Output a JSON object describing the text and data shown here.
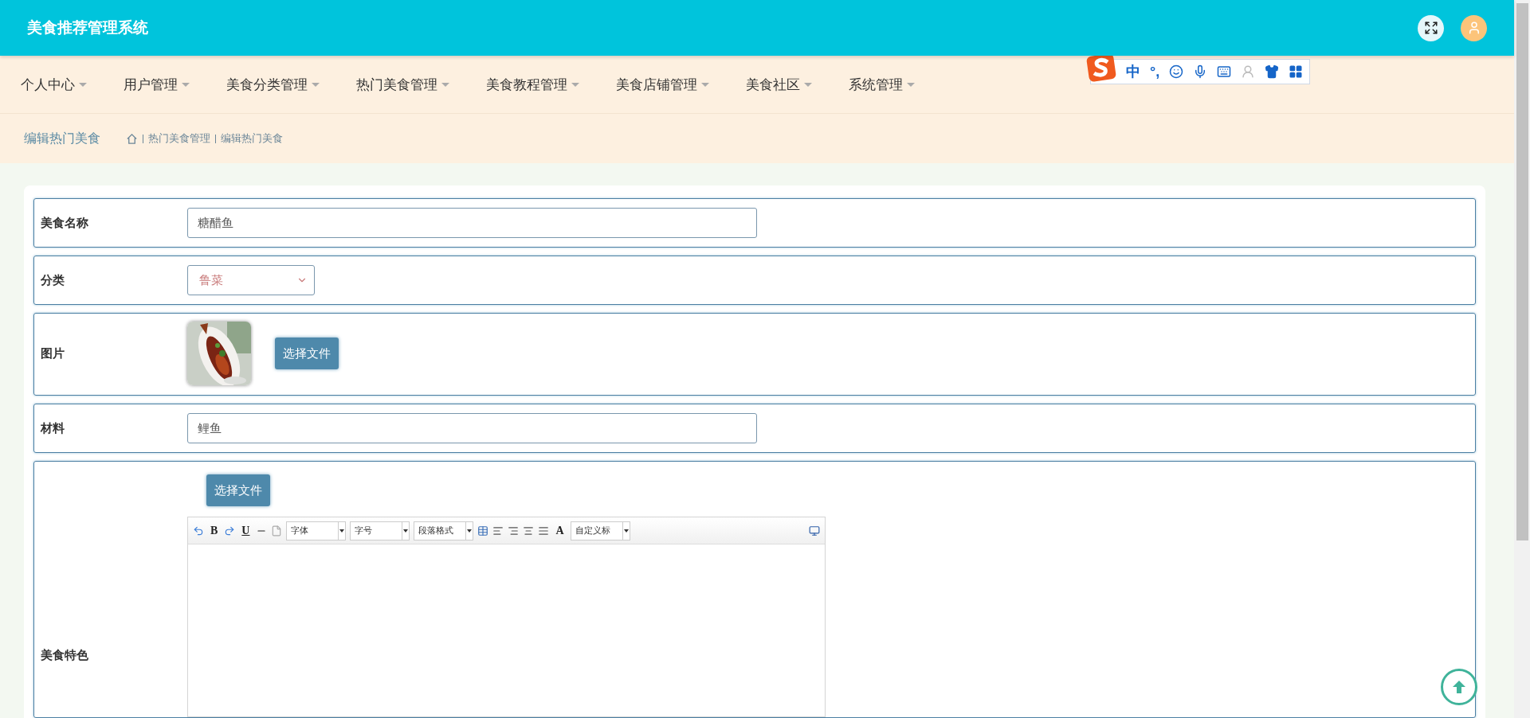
{
  "header": {
    "title": "美食推荐管理系统"
  },
  "ime_toolbar": {
    "mode": "中",
    "punctuation": "°,"
  },
  "menu": [
    {
      "label": "个人中心"
    },
    {
      "label": "用户管理"
    },
    {
      "label": "美食分类管理"
    },
    {
      "label": "热门美食管理"
    },
    {
      "label": "美食教程管理"
    },
    {
      "label": "美食店铺管理"
    },
    {
      "label": "美食社区"
    },
    {
      "label": "系统管理"
    }
  ],
  "breadcrumb": {
    "page_title": "编辑热门美食",
    "trail": [
      "热门美食管理",
      "编辑热门美食"
    ]
  },
  "form": {
    "fields": [
      {
        "kind": "text",
        "label": "美食名称",
        "value": "糖醋鱼"
      },
      {
        "kind": "select",
        "label": "分类",
        "value": "鲁菜"
      },
      {
        "label": "图片",
        "button": "选择文件"
      },
      {
        "kind": "text",
        "label": "材料",
        "value": "鲤鱼"
      },
      {
        "kind": "editor",
        "label": "美食特色",
        "button": "选择文件",
        "toolbar": {
          "bold": "B",
          "underline": "U",
          "font": "字体",
          "size": "字号",
          "paragraph": "段落格式",
          "text_color": "A",
          "custom_title": "自定义标"
        }
      }
    ]
  }
}
